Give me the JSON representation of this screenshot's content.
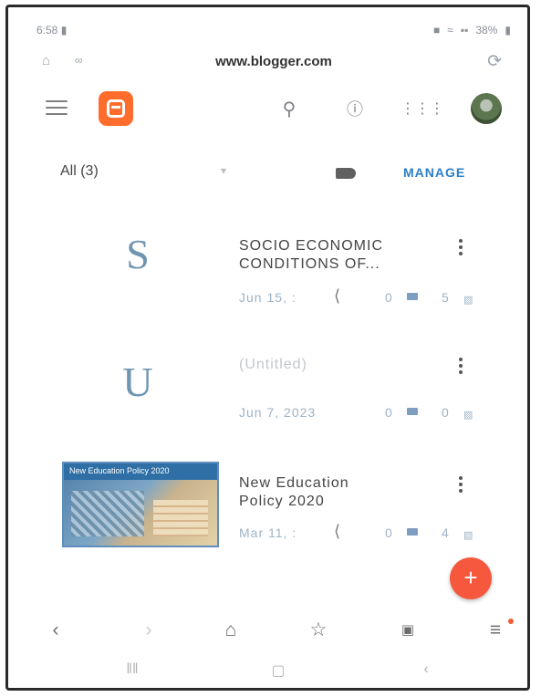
{
  "statusbar": {
    "time": "6:58",
    "battery": "38%"
  },
  "browser": {
    "url": "www.blogger.com"
  },
  "app": {
    "icons": [
      "menu-icon",
      "blogger-logo",
      "search-icon",
      "help-icon",
      "apps-icon",
      "avatar"
    ]
  },
  "filter": {
    "label": "All (3)",
    "manage_label": "MANAGE"
  },
  "posts": [
    {
      "letter": "S",
      "title_line1": "SOCIO ECONOMIC",
      "title_line2": "CONDITIONS OF...",
      "date": "Jun 15, :",
      "comments": "0",
      "views": "5"
    },
    {
      "letter": "U",
      "title_line1": "(Untitled)",
      "title_line2": "",
      "date": "Jun 7, 2023",
      "comments": "0",
      "views": "0"
    },
    {
      "thumb_caption": "New Education Policy 2020",
      "title_line1": "New Education",
      "title_line2": "Policy 2020",
      "date": "Mar 11, :",
      "comments": "0",
      "views": "4"
    }
  ],
  "fab_label": "+",
  "colors": {
    "accent": "#2a7fc6",
    "blogger_orange": "#ff6d2d",
    "fab": "#f5583c"
  }
}
